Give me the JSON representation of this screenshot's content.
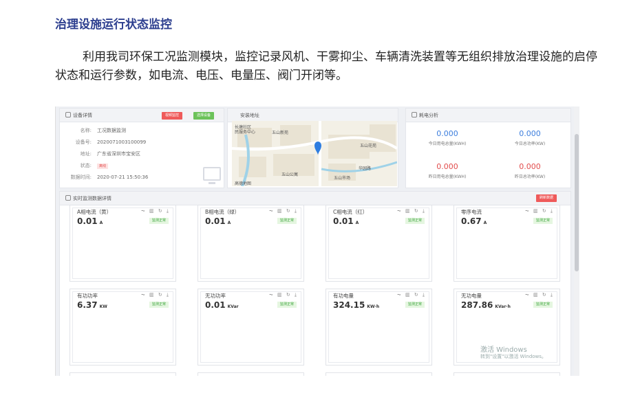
{
  "document": {
    "title": "治理设施运行状态监控",
    "paragraph": "利用我司环保工况监测模块，监控记录风机、干雾抑尘、车辆清洗装置等无组织排放治理设施的启停状态和运行参数，如电流、电压、电量压、阀门开闭等。"
  },
  "device_panel": {
    "title": "设备详情",
    "buttons": {
      "view_monitor": "视频监控",
      "select_device": "选择设备"
    },
    "fields": [
      {
        "key": "名称:",
        "value": "工况数据监测"
      },
      {
        "key": "设备号:",
        "value": "2020071003100099"
      },
      {
        "key": "地址:",
        "value": "广东省深圳市宝安区"
      },
      {
        "key": "状态:",
        "value": "离线"
      },
      {
        "key": "数据时间:",
        "value": "2020-07-21 15:50:36"
      }
    ]
  },
  "map_panel": {
    "title": "安装地址",
    "labels": [
      "五山新苑",
      "五山花苑",
      "五山公寓",
      "五山市场",
      "华园路",
      "高德地图",
      "长塘社区",
      "民服务中心"
    ]
  },
  "energy_panel": {
    "title": "耗电分析",
    "items": [
      {
        "value": "0.000",
        "label": "今日用电总量(KWH)",
        "color": "#3b7ddd"
      },
      {
        "value": "0.000",
        "label": "今日总功率(KW)",
        "color": "#3b7ddd"
      },
      {
        "value": "0.000",
        "label": "昨日用电总量(KWH)",
        "color": "#e24c4c"
      },
      {
        "value": "0.000",
        "label": "昨日总功率(KW)",
        "color": "#e24c4c"
      }
    ]
  },
  "realtime_panel": {
    "title": "实时监测数据详情",
    "refresh_label": "刷新数据",
    "tool_icons": "⏦ ▥ ↻ ⤓",
    "cards": [
      {
        "name": "A相电流（黄）",
        "value": "0.01",
        "unit": "A",
        "status": "监测正常"
      },
      {
        "name": "B相电流（绿）",
        "value": "0.01",
        "unit": "A",
        "status": "监测正常"
      },
      {
        "name": "C相电流（红）",
        "value": "0.01",
        "unit": "A",
        "status": "监测正常"
      },
      {
        "name": "零序电流",
        "value": "0.67",
        "unit": "A",
        "status": "监测正常"
      },
      {
        "name": "有功功率",
        "value": "6.37",
        "unit": "KW",
        "status": "监测正常"
      },
      {
        "name": "无功功率",
        "value": "0.01",
        "unit": "KVar",
        "status": "监测正常"
      },
      {
        "name": "有功电量",
        "value": "324.15",
        "unit": "KW·h",
        "status": "监测正常"
      },
      {
        "name": "无功电量",
        "value": "287.86",
        "unit": "KVar·h",
        "status": "监测正常"
      }
    ]
  },
  "watermark": {
    "line1": "激活 Windows",
    "line2": "转到\"设置\"以激活 Windows。"
  }
}
